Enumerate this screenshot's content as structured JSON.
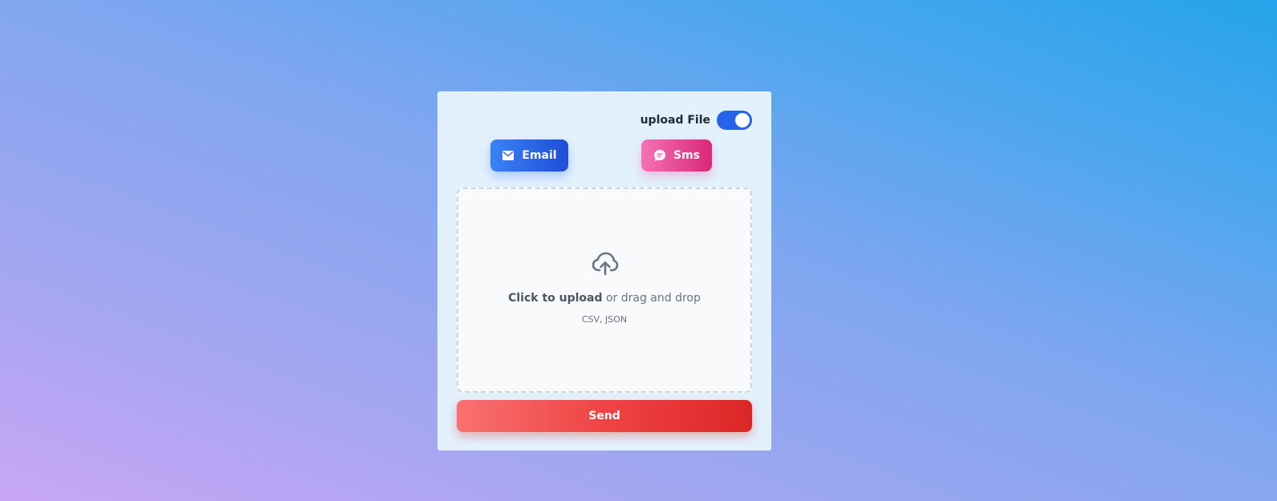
{
  "toggle": {
    "label": "upload File",
    "state": "on",
    "accent_color": "#2563eb"
  },
  "modes": {
    "email": {
      "label": "Email",
      "icon": "envelope-icon",
      "color": "#2563eb"
    },
    "sms": {
      "label": "Sms",
      "icon": "chat-bubble-icon",
      "color": "#ec4899"
    }
  },
  "dropzone": {
    "icon": "cloud-upload-icon",
    "click_text": "Click to upload",
    "drag_text": " or drag and drop",
    "formats": "CSV, JSON"
  },
  "send": {
    "label": "Send",
    "color": "#dc2626"
  }
}
